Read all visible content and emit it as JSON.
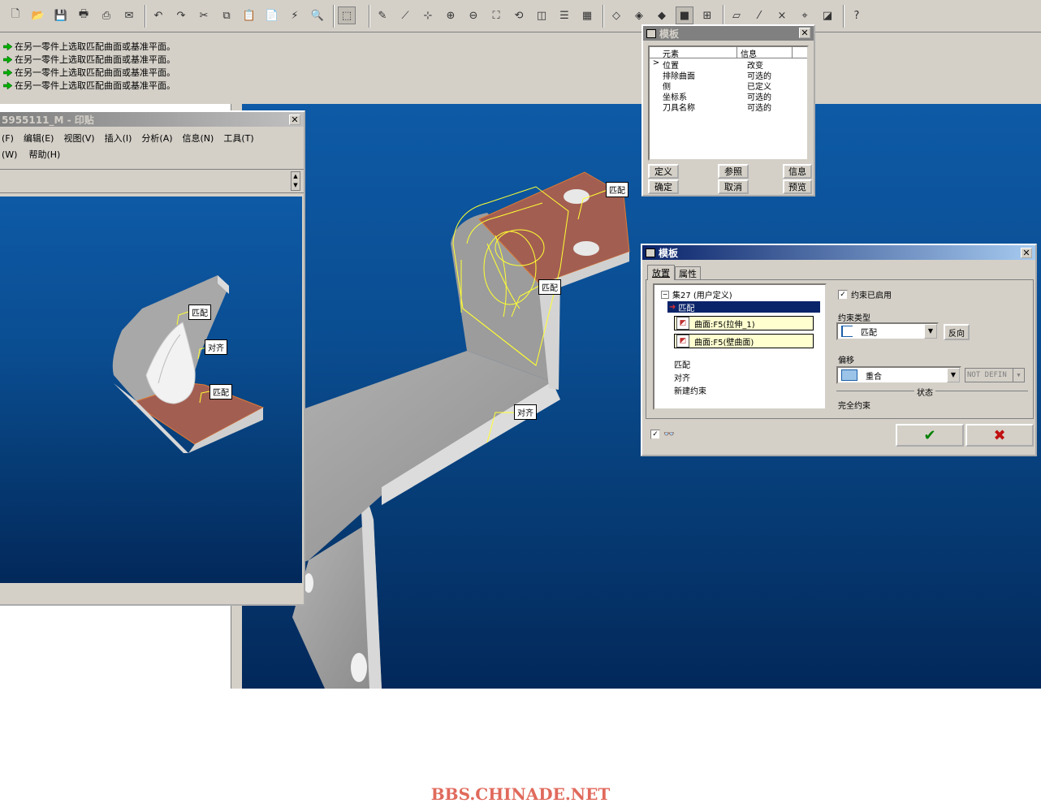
{
  "toolbar": {
    "icons": [
      "new-icon",
      "open-icon",
      "save-icon",
      "print-icon",
      "print-preview-icon",
      "email-icon",
      "undo-icon",
      "redo-icon",
      "cut-icon",
      "copy-icon",
      "paste-icon",
      "paste-special-icon",
      "regenerate-icon",
      "find-icon",
      "select-box-icon",
      "sketch-icon",
      "datum-axis-icon",
      "datum-point-icon",
      "zoom-in-icon",
      "zoom-out-icon",
      "refit-icon",
      "orient-icon",
      "saved-views-icon",
      "layers-icon",
      "view-manager-icon",
      "wireframe-icon",
      "hidden-line-icon",
      "no-hidden-icon",
      "shading-icon",
      "model-tree-icon",
      "datum-plane-icon",
      "datum-axis-display-icon",
      "datum-point-display-icon",
      "csys-display-icon",
      "annotation-icon",
      "help-icon"
    ]
  },
  "messages": [
    "在另一零件上选取匹配曲面或基准平面。",
    "在另一零件上选取匹配曲面或基准平面。",
    "在另一零件上选取匹配曲面或基准平面。",
    "在另一零件上选取匹配曲面或基准平面。"
  ],
  "sub_window": {
    "title": "5955111_M - 印贴",
    "menu_row1": [
      "(F)",
      "编辑(E)",
      "视图(V)",
      "插入(I)",
      "分析(A)",
      "信息(N)",
      "工具(T)"
    ],
    "menu_row2": [
      "(W)",
      "帮助(H)"
    ],
    "labels": [
      "匹配",
      "对齐",
      "匹配"
    ]
  },
  "main_labels": [
    "匹配",
    "匹配",
    "对齐"
  ],
  "template_small": {
    "title": "模板",
    "col_element": "元素",
    "col_info": "信息",
    "rows": [
      {
        "marker": ">",
        "element": "位置",
        "info": "改变"
      },
      {
        "marker": "",
        "element": "排除曲面",
        "info": "可选的"
      },
      {
        "marker": "",
        "element": "侧",
        "info": "已定义"
      },
      {
        "marker": "",
        "element": "坐标系",
        "info": "可选的"
      },
      {
        "marker": "",
        "element": "刀具名称",
        "info": "可选的"
      }
    ],
    "btn_define": "定义",
    "btn_reference": "参照",
    "btn_info": "信息",
    "btn_ok": "确定",
    "btn_cancel": "取消",
    "btn_preview": "预览"
  },
  "template_large": {
    "title": "模板",
    "tab_placement": "放置",
    "tab_properties": "属性",
    "tree_root": "集27 (用户定义)",
    "tree_selected": "匹配",
    "surface1": "曲面:F5(拉伸_1)",
    "surface2": "曲面:F5(壁曲面)",
    "tree_items": [
      "匹配",
      "对齐",
      "新建约束"
    ],
    "constraint_enabled": "约束已启用",
    "constraint_type_label": "约束类型",
    "constraint_type_value": "匹配",
    "flip_btn": "反向",
    "offset_label": "偏移",
    "offset_value": "重合",
    "offset_field": "NOT DEFIN",
    "status_label": "状态",
    "status_value": "完全约束"
  },
  "watermark": "BBS.CHINADE.NET"
}
